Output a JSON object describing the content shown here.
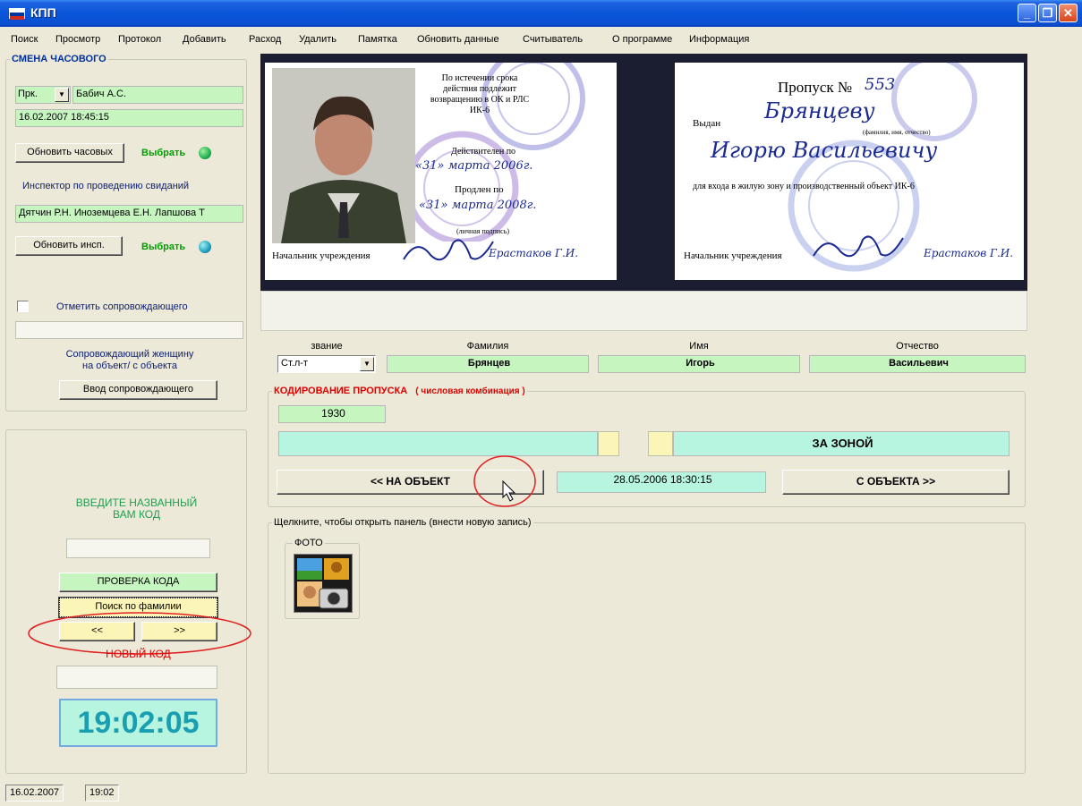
{
  "window": {
    "title": "КПП",
    "flag_colors": [
      "#ffffff",
      "#0033a0",
      "#d52b1e"
    ]
  },
  "menu": [
    "Поиск",
    "Просмотр",
    "Протокол",
    "Добавить",
    "Расход",
    "Удалить",
    "Памятка",
    "Обновить данные",
    "Считыватель",
    "О программе",
    "Информация"
  ],
  "guard": {
    "legend": "СМЕНА ЧАСОВОГО",
    "rank": "Прк.",
    "name": "Бабич А.С.",
    "datetime": "16.02.2007 18:45:15",
    "refresh_guards": "Обновить часовых",
    "select": "Выбрать",
    "inspector_label": "Инспектор по проведению свиданий",
    "inspectors": "Дятчин Р.Н. Иноземцева Е.Н. Лапшова Т",
    "refresh_insp": "Обновить инсп.",
    "select2": "Выбрать",
    "escort_check": "Отметить сопровождающего",
    "escort_value": "",
    "escort_desc": "Сопровождающий женщину\nна объект/ с объекта",
    "escort_btn": "Ввод сопровождающего"
  },
  "code_panel": {
    "prompt": "ВВЕДИТЕ НАЗВАННЫЙ\nВАМ КОД",
    "code_input": "",
    "check_btn": "ПРОВЕРКА КОДА",
    "search_btn": "Поиск по фамилии",
    "prev": "<<",
    "next": ">>",
    "new_code": "НОВЫЙ КОД",
    "new_code_value": "",
    "clock": "19:02:05"
  },
  "card_left": {
    "text1": "По истечении срока действия подлежит возвращению в ОК и РЛС ИК-6",
    "valid_until": "Действителен по",
    "date1": "«31» марта 2006г.",
    "extended": "Продлен по",
    "date2": "«31» марта 2008г.",
    "sign_note": "(личная подпись)",
    "chief": "Начальник учреждения",
    "chief_name": "Ерастаков Г.И."
  },
  "card_right": {
    "pass_no_label": "Пропуск №",
    "pass_no": "553",
    "issued": "Выдан",
    "surname_hand": "Брянцеву",
    "fio_note": "(фамилия, имя, отчество)",
    "name_hand": "Игорю Васильевичу",
    "purpose": "для входа в жилую зону и производственный объект ИК-6",
    "chief": "Начальник учреждения",
    "chief_name": "Ерастаков Г.И."
  },
  "person": {
    "labels": {
      "rank": "звание",
      "surname": "Фамилия",
      "name": "Имя",
      "patronymic": "Отчество"
    },
    "rank": "Ст.л-т",
    "surname": "Брянцев",
    "name": "Игорь",
    "patronymic": "Васильевич"
  },
  "coding": {
    "legend": "КОДИРОВАНИЕ ПРОПУСКА",
    "legend_hint": "( числовая комбинация )",
    "code": "1930",
    "left_bar": "",
    "zone_status": "ЗА ЗОНОЙ",
    "in_btn": "<< НА ОБЪЕКТ",
    "timestamp": "28.05.2006 18:30:15",
    "out_btn": "С ОБЪЕКТА >>"
  },
  "records": {
    "legend": "Щелкните, чтобы открыть панель (внести новую запись)",
    "photo_legend": "ФОТО"
  },
  "status": {
    "date": "16.02.2007",
    "time": "19:02"
  },
  "colors": {
    "accent_red": "#e00000",
    "field_green": "#c6f5c0",
    "clock": "#1a9fb0",
    "led": "#22b050"
  }
}
